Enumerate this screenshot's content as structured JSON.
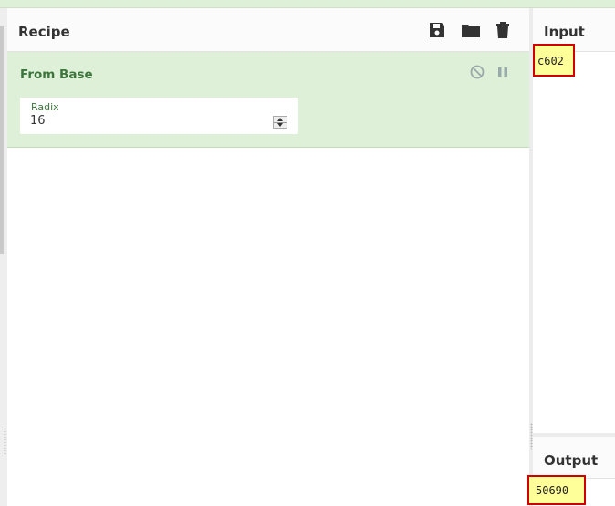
{
  "recipe": {
    "title": "Recipe",
    "icons": [
      "save-icon",
      "folder-icon",
      "trash-icon"
    ],
    "operations": [
      {
        "name": "From Base",
        "controls": [
          "disable-icon",
          "pause-icon"
        ],
        "args": [
          {
            "label": "Radix",
            "value": "16"
          }
        ]
      }
    ]
  },
  "input": {
    "title": "Input",
    "value": "c602"
  },
  "output": {
    "title": "Output",
    "value": "50690"
  },
  "colors": {
    "operation_bg": "#dff0d8",
    "operation_text": "#3c763d",
    "highlight_bg": "#ffff99",
    "highlight_border": "#d00000"
  }
}
